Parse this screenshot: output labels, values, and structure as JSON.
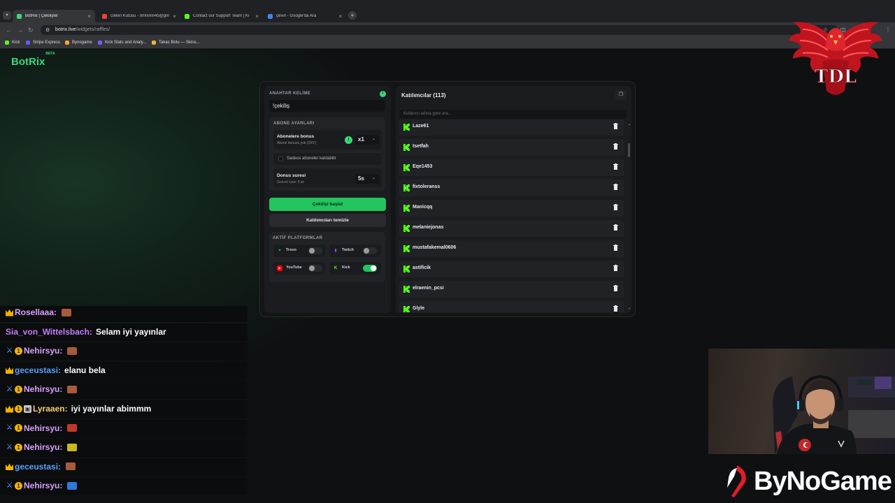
{
  "browser": {
    "tabs": [
      {
        "title": "BotRix | Çekilişler",
        "active": true,
        "favicon_color": "#3fd67a"
      },
      {
        "title": "Gelen Kutusu - nmnimn45@gm",
        "active": false,
        "favicon_color": "#ea4335"
      },
      {
        "title": "Contact our Support Team | Ki",
        "active": false,
        "favicon_color": "#53fc18"
      },
      {
        "title": "çeviri - Google'da Ara",
        "active": false,
        "favicon_color": "#4285f4"
      }
    ],
    "close_glyph": "×",
    "new_tab_glyph": "+",
    "url_host": "botrix.live",
    "url_path": "/widgets/raffles/",
    "bookmarks": [
      {
        "label": "Kick",
        "color": "#53fc18"
      },
      {
        "label": "Stripe Express",
        "color": "#635bff"
      },
      {
        "label": "Bynogame",
        "color": "#f5a623"
      },
      {
        "label": "Kick Stats and Analy...",
        "color": "#6c63ff"
      },
      {
        "label": "Takas Botu — Skins...",
        "color": "#e5b92e"
      }
    ]
  },
  "app": {
    "logo": "BotRix",
    "logo_badge": "BETA",
    "accent_color": "#22c55e"
  },
  "settings": {
    "keyword_label": "ANAHTAR KELİME",
    "keyword_value": "!çekiliş",
    "subscriber_section": "ABONE AYARLARI",
    "sub_bonus_title": "Abonelere bonus",
    "sub_bonus_sub": "Abone bonusu yok (OFF)",
    "sub_bonus_value": "x1",
    "sub_only_label": "Sadece aboneler katılabilir",
    "sub_only_checked": false,
    "duration_title": "Donus suresi",
    "duration_sub": "Guncel sure: 5 sn",
    "duration_value": "5s",
    "start_button": "Çekilişi başlat",
    "clear_button": "Katılımcıları temizle",
    "platforms_section": "AKTİF PLATFORMLAR",
    "platforms": [
      {
        "name": "Trovo",
        "enabled": false,
        "color": "#1ec27a"
      },
      {
        "name": "Twitch",
        "enabled": false,
        "color": "#9146ff"
      },
      {
        "name": "YouTube",
        "enabled": false,
        "color": "#ff0000"
      },
      {
        "name": "Kick",
        "enabled": true,
        "color": "#53fc18"
      }
    ]
  },
  "participants": {
    "header": "Katılımcılar (113)",
    "search_placeholder": "Kullanıcı adına gore ara...",
    "items": [
      "Laze61",
      "tsetfah",
      "Eqe1453",
      "fixtoleranss",
      "Manicqq",
      "melaniejonas",
      "mustafakemal0606",
      "astificik",
      "elraenin_pcsi",
      "Glyle"
    ]
  },
  "chat": {
    "messages": [
      {
        "badges": [
          "crown"
        ],
        "user": "Rosellaaa:",
        "user_color": "#d9a0ff",
        "text": "",
        "emote": "#a85a3c"
      },
      {
        "badges": [],
        "user": "Sia_von_Wittelsbach:",
        "user_color": "#c77dff",
        "text": "Selam iyi yayınlar",
        "emote": ""
      },
      {
        "badges": [
          "sword",
          "one"
        ],
        "user": "Nehirsyu:",
        "user_color": "#d9a0ff",
        "text": "",
        "emote": "#a85a3c"
      },
      {
        "badges": [
          "crown"
        ],
        "user": "geceustasi:",
        "user_color": "#5aa0ff",
        "text": "elanu bela",
        "emote": ""
      },
      {
        "badges": [
          "sword",
          "one"
        ],
        "user": "Nehirsyu:",
        "user_color": "#d9a0ff",
        "text": "",
        "emote": "#a85a3c"
      },
      {
        "badges": [
          "crown",
          "one",
          "box"
        ],
        "user": "Lyraaen:",
        "user_color": "#f7d070",
        "text": "iyi yayınlar abimmm",
        "emote": ""
      },
      {
        "badges": [
          "sword",
          "one"
        ],
        "user": "Nehirsyu:",
        "user_color": "#d9a0ff",
        "text": "",
        "emote": "#c0392b"
      },
      {
        "badges": [
          "sword",
          "one"
        ],
        "user": "Nehirsyu:",
        "user_color": "#d9a0ff",
        "text": "",
        "emote": "#c9b820"
      },
      {
        "badges": [
          "crown"
        ],
        "user": "geceustasi:",
        "user_color": "#5aa0ff",
        "text": "",
        "emote": "#a85a3c"
      },
      {
        "badges": [
          "sword",
          "one"
        ],
        "user": "Nehirsyu:",
        "user_color": "#d9a0ff",
        "text": "",
        "emote": "#2f7ad8"
      }
    ]
  },
  "overlay": {
    "sponsor_text": "ByNoGame",
    "corner_logo_text": "TDL"
  }
}
